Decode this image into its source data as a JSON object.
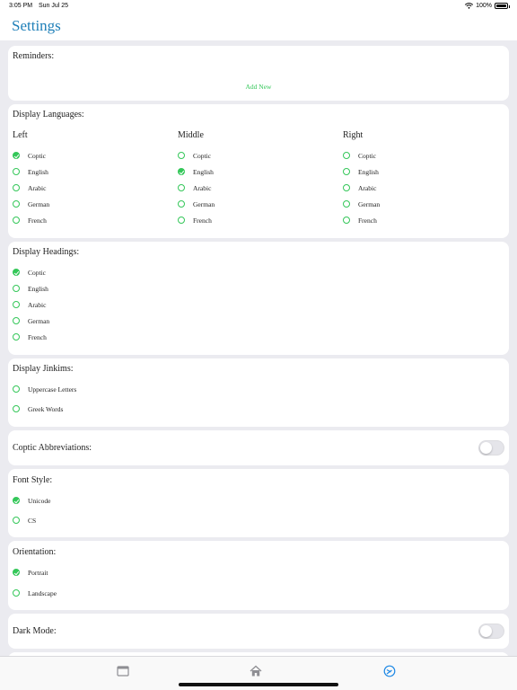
{
  "status_bar": {
    "time": "3:05 PM",
    "date": "Sun Jul 25",
    "battery": "100%"
  },
  "header": {
    "title": "Settings"
  },
  "reminders": {
    "title": "Reminders:",
    "add_new": "Add New"
  },
  "display_languages": {
    "title": "Display Languages:",
    "columns": [
      {
        "label": "Left",
        "options": [
          "Coptic",
          "English",
          "Arabic",
          "German",
          "French"
        ],
        "selected": "Coptic"
      },
      {
        "label": "Middle",
        "options": [
          "Coptic",
          "English",
          "Arabic",
          "German",
          "French"
        ],
        "selected": "English"
      },
      {
        "label": "Right",
        "options": [
          "Coptic",
          "English",
          "Arabic",
          "German",
          "French"
        ],
        "selected": ""
      }
    ]
  },
  "display_headings": {
    "title": "Display Headings:",
    "options": [
      "Coptic",
      "English",
      "Arabic",
      "German",
      "French"
    ],
    "selected": "Coptic"
  },
  "display_jinkims": {
    "title": "Display Jinkims:",
    "options": [
      "Uppercase Letters",
      "Greek Words"
    ],
    "selected": ""
  },
  "coptic_abbreviations": {
    "title": "Coptic Abbreviations:",
    "enabled": false
  },
  "font_style": {
    "title": "Font Style:",
    "options": [
      "Unicode",
      "CS"
    ],
    "selected": "Unicode"
  },
  "orientation": {
    "title": "Orientation:",
    "options": [
      "Portrait",
      "Landscape"
    ],
    "selected": "Portrait"
  },
  "dark_mode": {
    "title": "Dark Mode:",
    "enabled": false
  },
  "tabs": [
    {
      "icon": "calendar-icon"
    },
    {
      "icon": "home-icon"
    },
    {
      "icon": "settings-gauge-icon",
      "active": true
    }
  ],
  "colors": {
    "accent": "#34C759",
    "title_blue": "#1E7FB8",
    "tab_active": "#1E88E5",
    "tab_inactive": "#8E8E93",
    "background": "#EBEBF0"
  }
}
